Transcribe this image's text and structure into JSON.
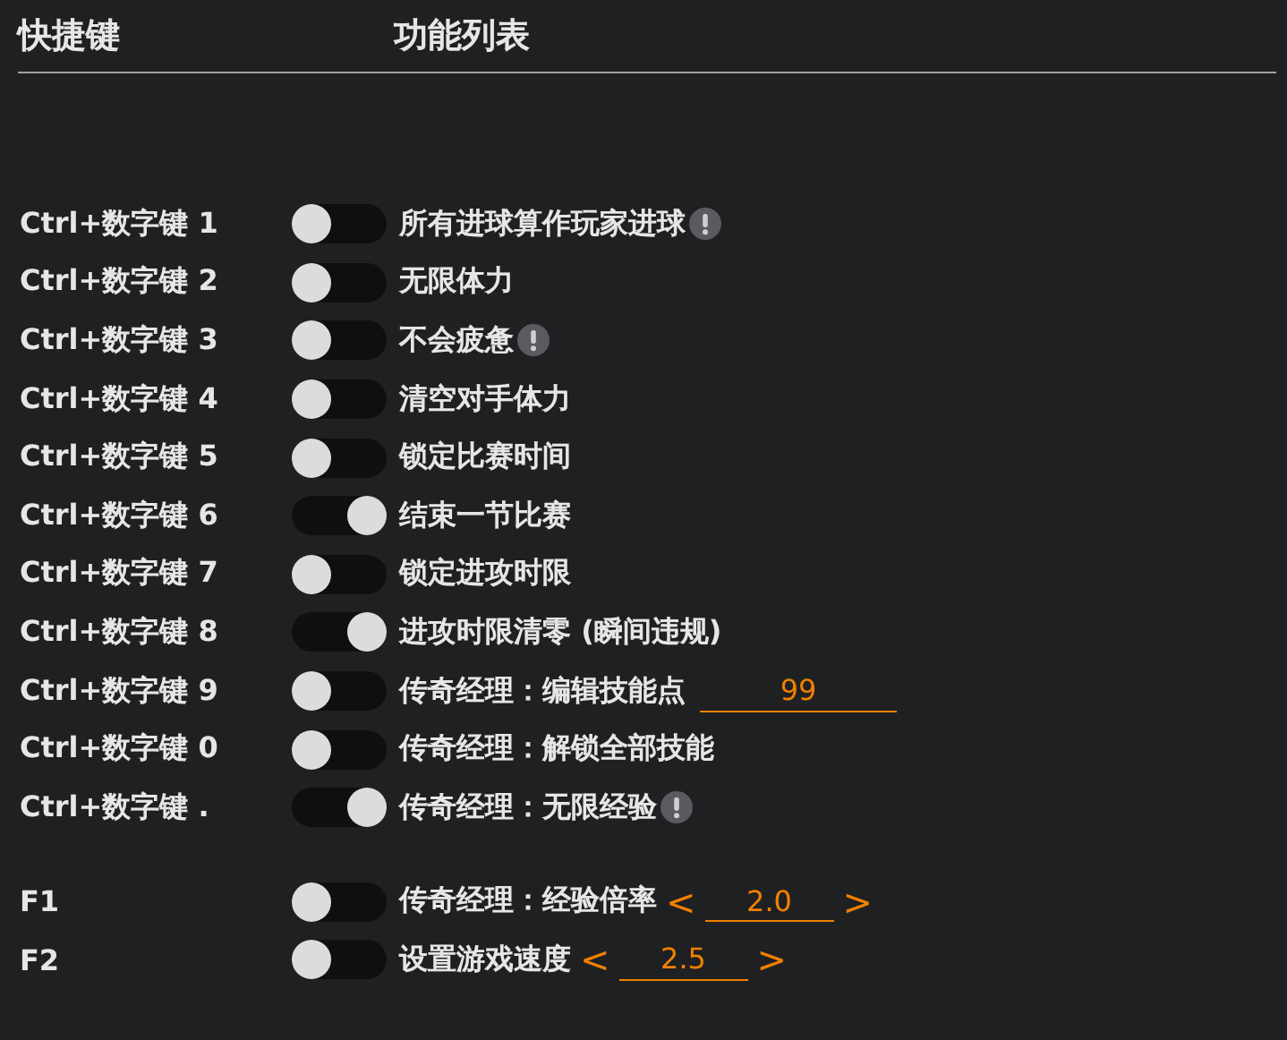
{
  "header": {
    "hotkey_column": "快捷键",
    "feature_column": "功能列表"
  },
  "groups": [
    {
      "rows": [
        {
          "key": "Ctrl+数字键 1",
          "on": false,
          "label": "所有进球算作玩家进球",
          "warning": true,
          "kind": "plain"
        },
        {
          "key": "Ctrl+数字键 2",
          "on": false,
          "label": "无限体力",
          "warning": false,
          "kind": "plain"
        },
        {
          "key": "Ctrl+数字键 3",
          "on": false,
          "label": "不会疲惫",
          "warning": true,
          "kind": "plain"
        },
        {
          "key": "Ctrl+数字键 4",
          "on": false,
          "label": "清空对手体力",
          "warning": false,
          "kind": "plain"
        },
        {
          "key": "Ctrl+数字键 5",
          "on": false,
          "label": "锁定比赛时间",
          "warning": false,
          "kind": "plain"
        },
        {
          "key": "Ctrl+数字键 6",
          "on": true,
          "label": "结束一节比赛",
          "warning": false,
          "kind": "plain"
        },
        {
          "key": "Ctrl+数字键 7",
          "on": false,
          "label": "锁定进攻时限",
          "warning": false,
          "kind": "plain"
        },
        {
          "key": "Ctrl+数字键 8",
          "on": true,
          "label": "进攻时限清零 (瞬间违规)",
          "warning": false,
          "kind": "plain"
        },
        {
          "key": "Ctrl+数字键 9",
          "on": false,
          "label": "传奇经理：编辑技能点",
          "warning": false,
          "kind": "input",
          "value": "99"
        },
        {
          "key": "Ctrl+数字键 0",
          "on": false,
          "label": "传奇经理：解锁全部技能",
          "warning": false,
          "kind": "plain"
        },
        {
          "key": "Ctrl+数字键 .",
          "on": true,
          "label": "传奇经理：无限经验",
          "warning": true,
          "kind": "plain"
        }
      ]
    },
    {
      "rows": [
        {
          "key": "F1",
          "on": false,
          "label": "传奇经理：经验倍率",
          "warning": false,
          "kind": "stepper",
          "prev": "<",
          "value": "2.0",
          "next": ">"
        },
        {
          "key": "F2",
          "on": false,
          "label": "设置游戏速度",
          "warning": false,
          "kind": "stepper",
          "prev": "<",
          "value": "2.5",
          "next": ">"
        }
      ]
    }
  ]
}
